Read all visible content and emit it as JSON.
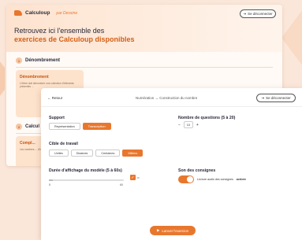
{
  "back_window": {
    "brand": "Calculoup",
    "brand_sub": "par Dessine",
    "logout_label": "Se déconnecter",
    "title_line1": "Retrouvez ici l'ensemble des",
    "title_line2": "exercices de Calculoup disponibles",
    "sections": [
      {
        "number": "1",
        "title": "Dénombrement",
        "card_title": "Dénombrement",
        "card_text": "L'élève doit dénombrer une collection d'éléments présentés ..."
      },
      {
        "number": "2",
        "title": "Calcul",
        "card_title": "Compl...",
        "card_text": "Les nombres ... d'images ..."
      }
    ]
  },
  "front_window": {
    "back_label": "Retour",
    "breadcrumb": "Numération → Construction du nombre",
    "logout_label": "Se déconnecter",
    "support": {
      "label": "Support",
      "options": [
        "Représentation",
        "Transcription"
      ],
      "selected": "Transcription"
    },
    "questions": {
      "label": "Nombre de questions (5 à 20)",
      "minus": "−",
      "value": "10",
      "plus": "+"
    },
    "target": {
      "label": "Cible de travail",
      "options": [
        "Unités",
        "Dizaines",
        "Centaines",
        "Milliers"
      ],
      "selected": "Milliers"
    },
    "duration": {
      "label": "Durée d'affichage du modèle (5 à 60s)",
      "min": "5",
      "max": "60",
      "infinite_label": "∞",
      "level": 0.05
    },
    "sound": {
      "label": "Son des consignes",
      "toggle_text": "Lecture audio des consignes",
      "toggle_state": "activée"
    },
    "launch_label": "Lancer l'exercice"
  },
  "colors": {
    "accent": "#e8772e",
    "background": "#fbe7da"
  }
}
